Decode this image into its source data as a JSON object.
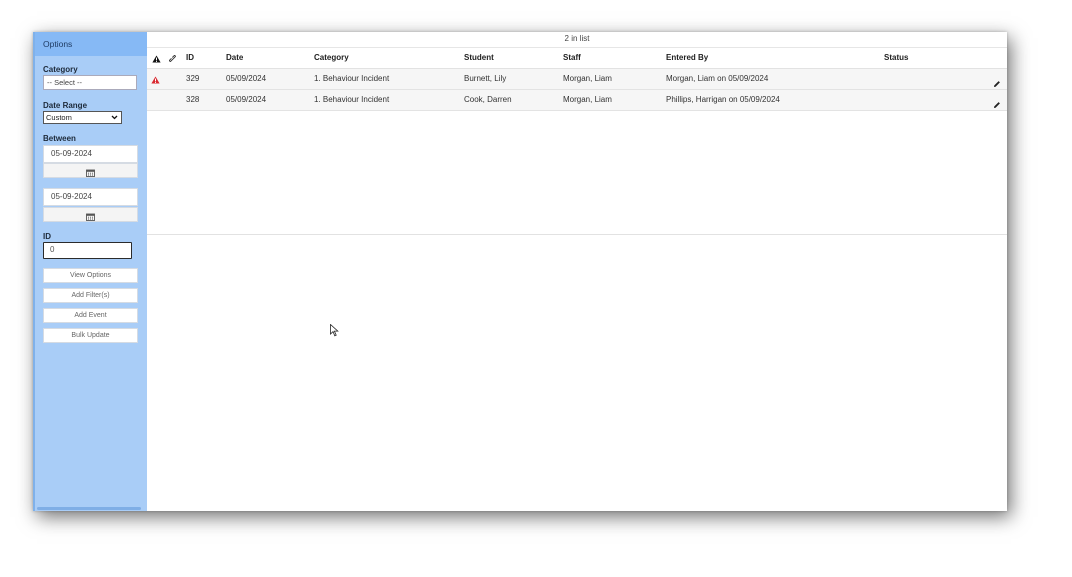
{
  "sidebar": {
    "header": "Options",
    "category_label": "Category",
    "category_placeholder": "-- Select --",
    "date_range_label": "Date Range",
    "date_range_value": "Custom",
    "between_label": "Between",
    "date_from": "05-09-2024",
    "date_to": "05-09-2024",
    "id_label": "ID",
    "id_value": "0",
    "buttons": {
      "view_options": "View Options",
      "add_filters": "Add Filter(s)",
      "add_event": "Add Event",
      "bulk_update": "Bulk Update"
    }
  },
  "list": {
    "count_text": "2 in list",
    "columns": {
      "id": "ID",
      "date": "Date",
      "category": "Category",
      "student": "Student",
      "staff": "Staff",
      "entered_by": "Entered By",
      "status": "Status"
    },
    "rows": [
      {
        "id": "329",
        "date": "05/09/2024",
        "category": "1. Behaviour Incident",
        "student": "Burnett, Lily",
        "staff": "Morgan, Liam",
        "entered_by": "Morgan, Liam on 05/09/2024",
        "status": "",
        "alert": true
      },
      {
        "id": "328",
        "date": "05/09/2024",
        "category": "1. Behaviour Incident",
        "student": "Cook, Darren",
        "staff": "Morgan, Liam",
        "entered_by": "Phillips, Harrigan on 05/09/2024",
        "status": "",
        "alert": false
      }
    ]
  },
  "colors": {
    "sidebar_bg": "#a9cdf7",
    "sidebar_header_bg": "#86b9f5",
    "alert_red": "#d9282f"
  },
  "icons": [
    "warning-icon",
    "link-icon",
    "calendar-icon",
    "pencil-icon",
    "cursor-icon"
  ]
}
